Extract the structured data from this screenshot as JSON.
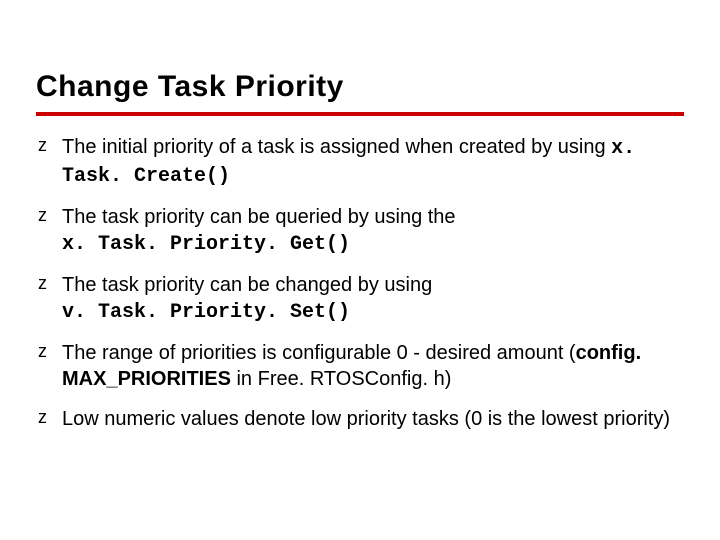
{
  "title": "Change Task Priority",
  "bullets": [
    {
      "text_a": "The initial priority of a task is assigned when created by using ",
      "code": "x. Task. Create()"
    },
    {
      "text_a": "The task priority can be queried by using the ",
      "code": "x. Task. Priority. Get()"
    },
    {
      "text_a": "The task priority can be changed by using ",
      "code": "v. Task. Priority. Set()"
    },
    {
      "text_a": "The range of priorities is configurable 0 - desired amount (",
      "bold": "config. MAX_PRIORITIES",
      "text_b": " in Free. RTOSConfig. h)"
    },
    {
      "text_a": "Low numeric values denote low priority tasks (0 is the lowest priority)"
    }
  ]
}
